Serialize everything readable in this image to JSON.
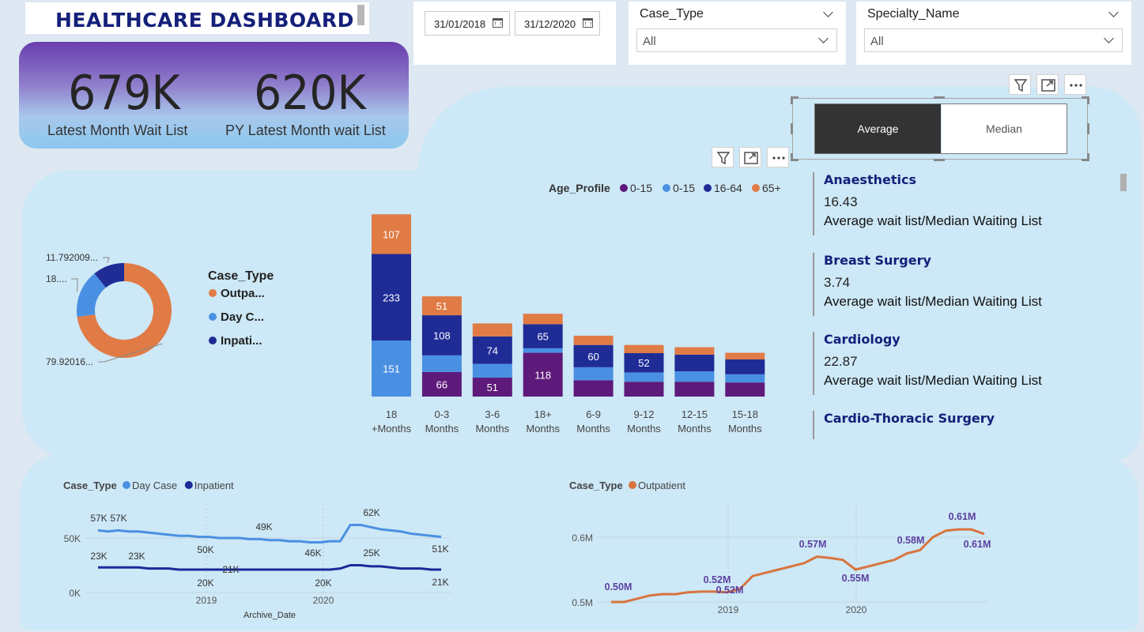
{
  "header": {
    "title": "HEALTHCARE  DASHBOARD"
  },
  "kpis": [
    {
      "value": "679K",
      "label": "Latest Month Wait List"
    },
    {
      "value": "620K",
      "label": "PY Latest Month wait List"
    }
  ],
  "date_range": {
    "start": "31/01/2018",
    "end": "31/12/2020"
  },
  "slicers": [
    {
      "title": "Case_Type",
      "selected": "All"
    },
    {
      "title": "Specialty_Name",
      "selected": "All"
    }
  ],
  "toggle": {
    "options": [
      "Average",
      "Median"
    ],
    "selected": "Average"
  },
  "icons": {
    "filter": "filter-icon",
    "focus": "focus-mode-icon",
    "more": "more-options-icon",
    "calendar": "calendar-icon"
  },
  "colors": {
    "outpatient": "#e07b45",
    "day_case": "#4a90e2",
    "inpatient": "#1f2c96",
    "age_0_15_a": "#5e1a7a",
    "title": "#15207a"
  },
  "specialties": [
    {
      "name": "Anaesthetics",
      "value": "16.43",
      "label": "Average wait list/Median Waiting List"
    },
    {
      "name": "Breast Surgery",
      "value": "3.74",
      "label": "Average wait list/Median Waiting List"
    },
    {
      "name": "Cardiology",
      "value": "22.87",
      "label": "Average wait list/Median Waiting List"
    },
    {
      "name": "Cardio-Thoracic Surgery",
      "value": "",
      "label": ""
    }
  ],
  "chart_data": [
    {
      "type": "pie",
      "legend_title": "Case_Type",
      "legend": [
        "Outpa...",
        "Day C...",
        "Inpati..."
      ],
      "values": [
        79.92016,
        18.0,
        11.792009
      ],
      "data_labels": [
        "79.92016...",
        "18....",
        "11.792009..."
      ],
      "colors": [
        "#e07b45",
        "#4a90e2",
        "#1f2c96"
      ]
    },
    {
      "type": "bar",
      "legend_title": "Age_Profile",
      "legend": [
        "0-15",
        "0-15",
        "16-64",
        "65+"
      ],
      "categories": [
        "18 +Months",
        "0-3 Months",
        "3-6 Months",
        "18+ Months",
        "6-9 Months",
        "9-12 Months",
        "12-15 Months",
        "15-18 Months"
      ],
      "category_lines": [
        [
          "18",
          "+Months"
        ],
        [
          "0-3",
          "Months"
        ],
        [
          "3-6",
          "Months"
        ],
        [
          "18+",
          "Months"
        ],
        [
          "6-9",
          "Months"
        ],
        [
          "9-12",
          "Months"
        ],
        [
          "12-15",
          "Months"
        ],
        [
          "15-18",
          "Months"
        ]
      ],
      "series": [
        {
          "name": "0-15",
          "color": "#5e1a7a",
          "values": [
            0,
            66,
            51,
            118,
            44,
            40,
            40,
            38
          ]
        },
        {
          "name": "0-15",
          "color": "#4a90e2",
          "values": [
            151,
            45,
            37,
            12,
            35,
            25,
            28,
            22
          ]
        },
        {
          "name": "16-64",
          "color": "#1f2c96",
          "values": [
            233,
            108,
            74,
            65,
            60,
            52,
            45,
            40
          ]
        },
        {
          "name": "65+",
          "color": "#e07b45",
          "values": [
            107,
            51,
            35,
            28,
            25,
            22,
            20,
            18
          ]
        }
      ],
      "ylim": [
        0,
        500
      ]
    },
    {
      "type": "line",
      "legend_title": "Case_Type",
      "legend": [
        "Day Case",
        "Inpatient"
      ],
      "xlabel": "Archive_Date",
      "x_ticks": [
        "2019",
        "2020"
      ],
      "y_ticks": [
        "0K",
        "50K"
      ],
      "ylim": [
        0,
        70
      ],
      "series": [
        {
          "name": "Day Case",
          "color": "#4a90e2",
          "values": [
            57,
            56,
            57,
            56,
            56,
            55,
            54,
            53,
            52,
            52,
            51,
            51,
            50,
            50,
            50,
            49,
            49,
            48,
            48,
            47,
            47,
            46,
            46,
            47,
            47,
            62,
            62,
            60,
            58,
            57,
            56,
            54,
            53,
            52,
            51
          ],
          "labels": [
            "57K",
            "57K",
            "50K",
            "49K",
            "46K",
            "62K",
            "51K"
          ]
        },
        {
          "name": "Inpatient",
          "color": "#1a2a9a",
          "values": [
            23,
            23,
            23,
            23,
            23,
            22,
            22,
            22,
            21,
            21,
            21,
            21,
            21,
            21,
            21,
            21,
            21,
            21,
            21,
            21,
            21,
            21,
            21,
            21,
            22,
            25,
            25,
            24,
            24,
            23,
            22,
            22,
            22,
            21,
            21
          ],
          "labels": [
            "23K",
            "23K",
            "20K",
            "21K",
            "20K",
            "25K",
            "21K"
          ]
        }
      ]
    },
    {
      "type": "line",
      "legend_title": "Case_Type",
      "legend": [
        "Outpatient"
      ],
      "x_ticks": [
        "2019",
        "2020"
      ],
      "y_ticks": [
        "0.5M",
        "0.6M"
      ],
      "ylim": [
        0.5,
        0.62
      ],
      "series": [
        {
          "name": "Outpatient",
          "color": "#d8743f",
          "values": [
            0.5,
            0.5,
            0.505,
            0.51,
            0.512,
            0.512,
            0.515,
            0.516,
            0.516,
            0.515,
            0.52,
            0.54,
            0.545,
            0.55,
            0.555,
            0.56,
            0.57,
            0.568,
            0.565,
            0.55,
            0.555,
            0.56,
            0.565,
            0.575,
            0.58,
            0.6,
            0.61,
            0.612,
            0.612,
            0.605
          ],
          "labels": [
            "0.50M",
            "0.52M",
            "0.52M",
            "0.57M",
            "0.55M",
            "0.58M",
            "0.61M",
            "0.61M"
          ]
        }
      ]
    }
  ]
}
